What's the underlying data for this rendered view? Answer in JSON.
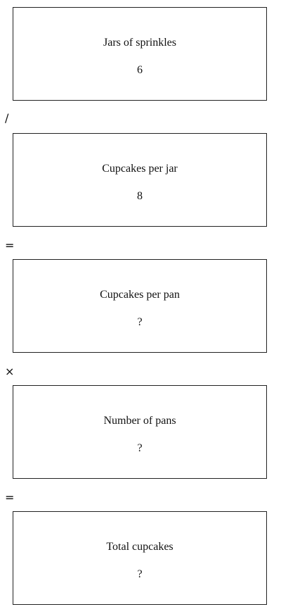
{
  "boxes": [
    {
      "label": "Jars of sprinkles",
      "value": "6"
    },
    {
      "label": "Cupcakes per jar",
      "value": "8"
    },
    {
      "label": "Cupcakes per pan",
      "value": "?"
    },
    {
      "label": "Number of pans",
      "value": "?"
    },
    {
      "label": "Total cupcakes",
      "value": "?"
    }
  ],
  "operators": [
    "/",
    "=",
    "×",
    "="
  ]
}
